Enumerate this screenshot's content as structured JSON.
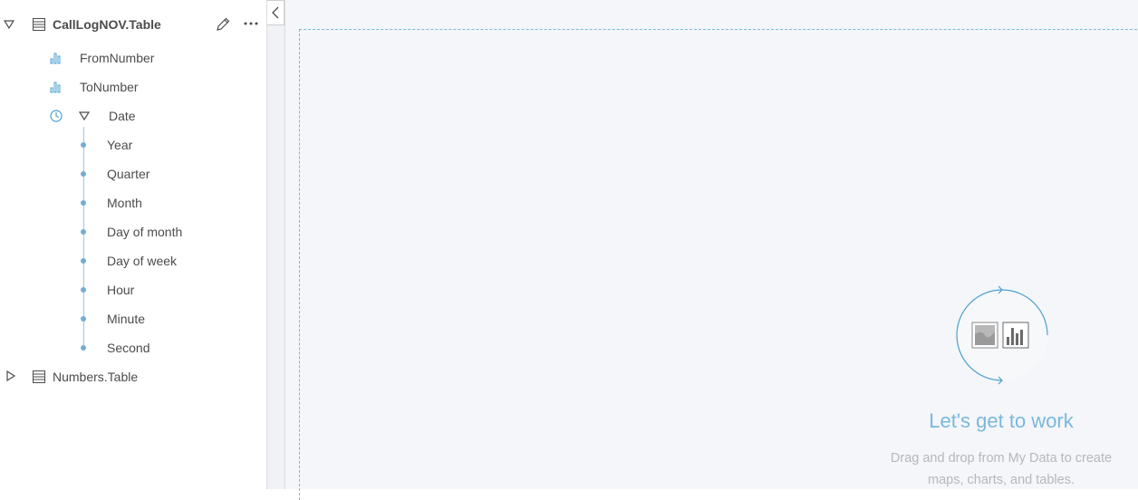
{
  "dataset_tree": {
    "datasets": [
      {
        "name": "CallLogNOV.Table",
        "expanded": true,
        "fields": [
          {
            "label": "FromNumber",
            "icon": "number-field-icon"
          },
          {
            "label": "ToNumber",
            "icon": "number-field-icon"
          },
          {
            "label": "Date",
            "icon": "date-field-icon",
            "expanded": true,
            "subfields": [
              "Year",
              "Quarter",
              "Month",
              "Day of month",
              "Day of week",
              "Hour",
              "Minute",
              "Second"
            ]
          }
        ]
      },
      {
        "name": "Numbers.Table",
        "expanded": false
      }
    ]
  },
  "empty_state": {
    "title": "Let's get to work",
    "description_line1": "Drag and drop from My Data to create",
    "description_line2": "maps, charts, and tables."
  },
  "colors": {
    "accent": "#7ab8dc",
    "dot": "#73aed2",
    "page_bg": "#f4f6f9",
    "hint_text": "#b5b8bc"
  }
}
